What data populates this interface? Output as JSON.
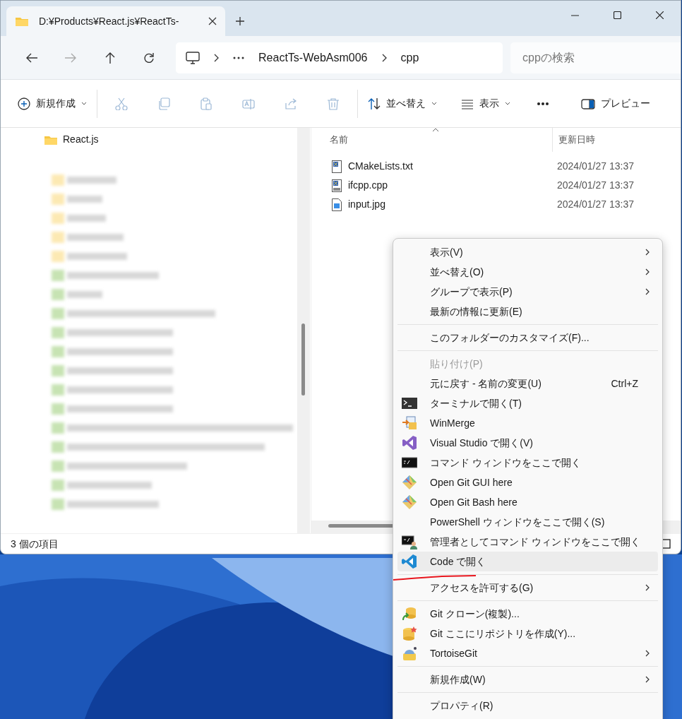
{
  "window": {
    "tab_title": "D:¥Products¥React.js¥ReactTs-"
  },
  "address_bar": {
    "breadcrumbs": [
      "ReactTs-WebAsm006",
      "cpp"
    ],
    "search": {
      "placeholder": "cppの検索"
    }
  },
  "toolbar": [
    {
      "kind": "new",
      "label": "新規作成",
      "dropdown": true,
      "disabled": false
    },
    {
      "kind": "cut",
      "disabled": true
    },
    {
      "kind": "copy",
      "disabled": true
    },
    {
      "kind": "paste",
      "disabled": true
    },
    {
      "kind": "rename",
      "disabled": true
    },
    {
      "kind": "share",
      "disabled": true
    },
    {
      "kind": "delete",
      "disabled": true
    },
    {
      "kind": "sort",
      "label": "並べ替え",
      "dropdown": true,
      "disabled": false
    },
    {
      "kind": "view",
      "label": "表示",
      "dropdown": true,
      "disabled": false
    },
    {
      "kind": "more",
      "disabled": false
    },
    {
      "kind": "preview",
      "label": "プレビュー",
      "disabled": false
    }
  ],
  "nav_pane": {
    "items": [
      {
        "label": "React.js"
      }
    ]
  },
  "file_list": {
    "columns": [
      {
        "label": "名前",
        "sorted": true
      },
      {
        "label": "更新日時",
        "sorted": false
      }
    ],
    "rows": [
      {
        "name": "CMakeLists.txt",
        "modified": "2024/01/27 13:37",
        "kind": "text"
      },
      {
        "name": "ifcpp.cpp",
        "modified": "2024/01/27 13:37",
        "kind": "source"
      },
      {
        "name": "input.jpg",
        "modified": "2024/01/27 13:37",
        "kind": "image"
      }
    ]
  },
  "status_bar": {
    "item_count": "3 個の項目"
  },
  "context_menu": {
    "items": [
      {
        "kind": "plain",
        "label": "表示(V)",
        "submenu": true,
        "disabled": false,
        "highlighted": false
      },
      {
        "kind": "plain",
        "label": "並べ替え(O)",
        "submenu": true,
        "disabled": false,
        "highlighted": false
      },
      {
        "kind": "plain",
        "label": "グループで表示(P)",
        "submenu": true,
        "disabled": false,
        "highlighted": false
      },
      {
        "kind": "plain",
        "label": "最新の情報に更新(E)",
        "submenu": false,
        "disabled": false,
        "highlighted": false
      },
      {
        "kind": "separator"
      },
      {
        "kind": "plain",
        "label": "このフォルダーのカスタマイズ(F)...",
        "submenu": false,
        "disabled": false,
        "highlighted": false
      },
      {
        "kind": "separator"
      },
      {
        "kind": "plain",
        "label": "貼り付け(P)",
        "submenu": false,
        "disabled": true,
        "highlighted": false
      },
      {
        "kind": "plain",
        "label": "元に戻す - 名前の変更(U)",
        "shortcut": "Ctrl+Z",
        "submenu": false,
        "disabled": false,
        "highlighted": false
      },
      {
        "kind": "terminal",
        "label": "ターミナルで開く(T)",
        "submenu": false,
        "disabled": false,
        "highlighted": false
      },
      {
        "kind": "winmerge",
        "label": "WinMerge",
        "submenu": false,
        "disabled": false,
        "highlighted": false
      },
      {
        "kind": "visualstudio",
        "label": "Visual Studio で開く(V)",
        "submenu": false,
        "disabled": false,
        "highlighted": false
      },
      {
        "kind": "cmd",
        "label": "コマンド ウィンドウをここで開く",
        "submenu": false,
        "disabled": false,
        "highlighted": false
      },
      {
        "kind": "git",
        "label": "Open Git GUI here",
        "submenu": false,
        "disabled": false,
        "highlighted": false
      },
      {
        "kind": "git",
        "label": "Open Git Bash here",
        "submenu": false,
        "disabled": false,
        "highlighted": false
      },
      {
        "kind": "plain",
        "label": "PowerShell ウィンドウをここで開く(S)",
        "submenu": false,
        "disabled": false,
        "highlighted": false
      },
      {
        "kind": "admincmd",
        "label": "管理者としてコマンド ウィンドウをここで開く",
        "submenu": false,
        "disabled": false,
        "highlighted": false
      },
      {
        "kind": "vscode",
        "label": "Code で開く",
        "submenu": false,
        "disabled": false,
        "highlighted": true,
        "annotated": true
      },
      {
        "kind": "separator"
      },
      {
        "kind": "plain",
        "label": "アクセスを許可する(G)",
        "submenu": true,
        "disabled": false,
        "highlighted": false
      },
      {
        "kind": "separator"
      },
      {
        "kind": "gitclone",
        "label": "Git クローン(複製)...",
        "submenu": false,
        "disabled": false,
        "highlighted": false
      },
      {
        "kind": "gitrepo",
        "label": "Git ここにリポジトリを作成(Y)...",
        "submenu": false,
        "disabled": false,
        "highlighted": false
      },
      {
        "kind": "tortoise",
        "label": "TortoiseGit",
        "submenu": true,
        "disabled": false,
        "highlighted": false
      },
      {
        "kind": "separator"
      },
      {
        "kind": "plain",
        "label": "新規作成(W)",
        "submenu": true,
        "disabled": false,
        "highlighted": false
      },
      {
        "kind": "separator"
      },
      {
        "kind": "plain",
        "label": "プロパティ(R)",
        "submenu": false,
        "disabled": false,
        "highlighted": false
      }
    ]
  }
}
